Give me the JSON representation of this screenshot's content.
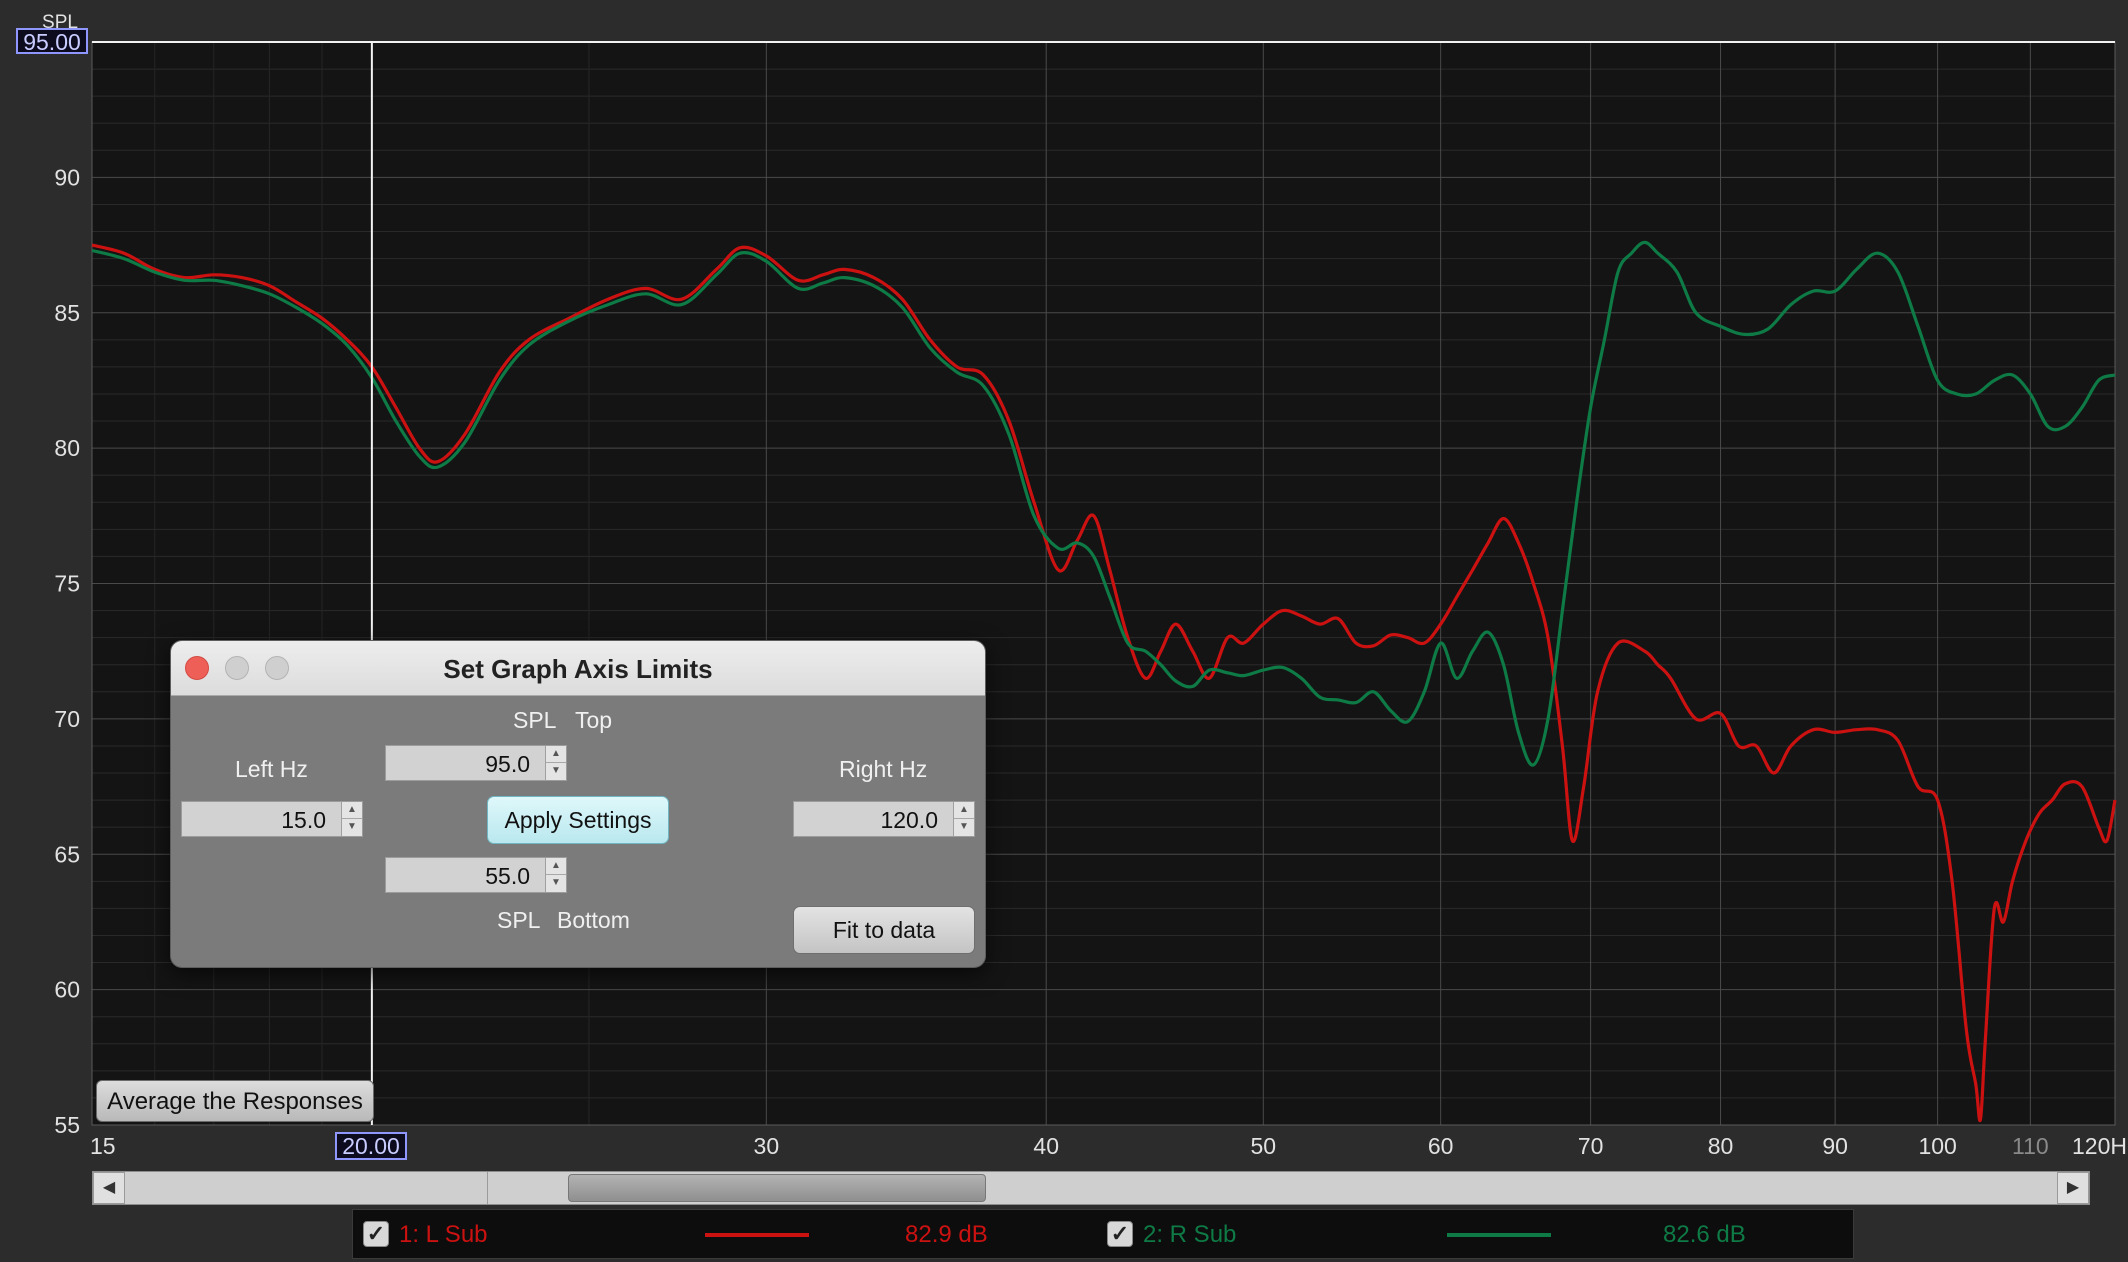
{
  "graph": {
    "y_axis_label": "SPL",
    "y_cursor_value": "95.00",
    "x_cursor_value": "20.00",
    "y_ticks": [
      "90",
      "85",
      "80",
      "75",
      "70",
      "65",
      "60",
      "55"
    ],
    "x_ticks": [
      "15",
      "30",
      "40",
      "50",
      "60",
      "70",
      "80",
      "90",
      "100",
      "110",
      "120H"
    ]
  },
  "chart_data": {
    "type": "line",
    "x_scale": "log",
    "xlim": [
      15,
      120
    ],
    "ylim": [
      55,
      95
    ],
    "ylabel": "SPL",
    "grid": true,
    "cursor": {
      "x": 20,
      "y": 95
    },
    "series": [
      {
        "name": "1: L Sub",
        "color": "#cc1111",
        "points": [
          [
            15,
            87.5
          ],
          [
            15.5,
            87.2
          ],
          [
            16,
            86.6
          ],
          [
            16.5,
            86.3
          ],
          [
            17,
            86.4
          ],
          [
            17.5,
            86.3
          ],
          [
            18,
            86.0
          ],
          [
            18.5,
            85.4
          ],
          [
            19,
            84.8
          ],
          [
            19.5,
            84.0
          ],
          [
            20,
            83.0
          ],
          [
            20.5,
            81.5
          ],
          [
            21,
            80.0
          ],
          [
            21.4,
            79.5
          ],
          [
            22,
            80.5
          ],
          [
            22.8,
            82.8
          ],
          [
            23.5,
            84.0
          ],
          [
            24.5,
            84.8
          ],
          [
            25.5,
            85.5
          ],
          [
            26.5,
            85.9
          ],
          [
            27.5,
            85.5
          ],
          [
            28.5,
            86.6
          ],
          [
            29.2,
            87.4
          ],
          [
            30,
            87.1
          ],
          [
            31,
            86.2
          ],
          [
            31.8,
            86.4
          ],
          [
            32.5,
            86.6
          ],
          [
            33.5,
            86.3
          ],
          [
            34.5,
            85.5
          ],
          [
            35.5,
            84.0
          ],
          [
            36.5,
            83.0
          ],
          [
            37.5,
            82.7
          ],
          [
            38.5,
            81.0
          ],
          [
            39.5,
            78.0
          ],
          [
            40.5,
            75.5
          ],
          [
            41.3,
            76.6
          ],
          [
            42,
            77.5
          ],
          [
            42.7,
            75.5
          ],
          [
            43.5,
            73.0
          ],
          [
            44.3,
            71.5
          ],
          [
            45,
            72.5
          ],
          [
            45.7,
            73.5
          ],
          [
            46.5,
            72.5
          ],
          [
            47.3,
            71.5
          ],
          [
            48.2,
            73.0
          ],
          [
            49,
            72.8
          ],
          [
            50,
            73.5
          ],
          [
            51,
            74.0
          ],
          [
            52,
            73.8
          ],
          [
            53,
            73.5
          ],
          [
            54,
            73.7
          ],
          [
            55,
            72.8
          ],
          [
            56,
            72.7
          ],
          [
            57,
            73.1
          ],
          [
            58,
            73.0
          ],
          [
            59,
            72.8
          ],
          [
            60,
            73.5
          ],
          [
            61,
            74.5
          ],
          [
            62,
            75.5
          ],
          [
            63,
            76.5
          ],
          [
            64,
            77.4
          ],
          [
            65,
            76.5
          ],
          [
            66,
            75.0
          ],
          [
            67,
            73.0
          ],
          [
            68,
            69.0
          ],
          [
            68.7,
            65.5
          ],
          [
            69.5,
            67.5
          ],
          [
            70.5,
            71.0
          ],
          [
            72,
            72.8
          ],
          [
            74,
            72.5
          ],
          [
            75,
            72.0
          ],
          [
            76,
            71.5
          ],
          [
            78,
            70.0
          ],
          [
            80,
            70.2
          ],
          [
            81.5,
            69.0
          ],
          [
            83,
            69.0
          ],
          [
            84.5,
            68.0
          ],
          [
            86,
            69.0
          ],
          [
            88,
            69.6
          ],
          [
            90,
            69.5
          ],
          [
            92,
            69.6
          ],
          [
            94,
            69.6
          ],
          [
            96,
            69.2
          ],
          [
            98,
            67.5
          ],
          [
            100,
            67.0
          ],
          [
            101.5,
            64.0
          ],
          [
            103,
            58.5
          ],
          [
            104,
            56.5
          ],
          [
            104.5,
            55.2
          ],
          [
            105,
            58.0
          ],
          [
            106,
            63.0
          ],
          [
            107,
            62.5
          ],
          [
            108,
            64.0
          ],
          [
            109.5,
            65.5
          ],
          [
            111,
            66.5
          ],
          [
            112.5,
            67.0
          ],
          [
            114,
            67.6
          ],
          [
            116,
            67.5
          ],
          [
            118,
            66.0
          ],
          [
            119,
            65.5
          ],
          [
            120,
            67.0
          ]
        ]
      },
      {
        "name": "2: R Sub",
        "color": "#0e7a45",
        "points": [
          [
            15,
            87.3
          ],
          [
            15.5,
            87.0
          ],
          [
            16,
            86.5
          ],
          [
            16.5,
            86.2
          ],
          [
            17,
            86.2
          ],
          [
            17.5,
            86.0
          ],
          [
            18,
            85.7
          ],
          [
            18.5,
            85.2
          ],
          [
            19,
            84.6
          ],
          [
            19.5,
            83.8
          ],
          [
            20,
            82.6
          ],
          [
            20.5,
            81.0
          ],
          [
            21,
            79.7
          ],
          [
            21.4,
            79.3
          ],
          [
            22,
            80.2
          ],
          [
            22.8,
            82.5
          ],
          [
            23.5,
            83.8
          ],
          [
            24.5,
            84.7
          ],
          [
            25.5,
            85.3
          ],
          [
            26.5,
            85.7
          ],
          [
            27.5,
            85.3
          ],
          [
            28.5,
            86.4
          ],
          [
            29.2,
            87.2
          ],
          [
            30,
            86.9
          ],
          [
            31,
            85.9
          ],
          [
            31.8,
            86.1
          ],
          [
            32.5,
            86.3
          ],
          [
            33.5,
            86.0
          ],
          [
            34.5,
            85.2
          ],
          [
            35.5,
            83.7
          ],
          [
            36.5,
            82.8
          ],
          [
            37.5,
            82.3
          ],
          [
            38.5,
            80.5
          ],
          [
            39.5,
            77.5
          ],
          [
            40.5,
            76.3
          ],
          [
            41.3,
            76.5
          ],
          [
            42,
            76.0
          ],
          [
            42.7,
            74.5
          ],
          [
            43.5,
            72.8
          ],
          [
            44.3,
            72.5
          ],
          [
            45,
            72.0
          ],
          [
            45.7,
            71.4
          ],
          [
            46.5,
            71.2
          ],
          [
            47.3,
            71.8
          ],
          [
            48.2,
            71.7
          ],
          [
            49,
            71.6
          ],
          [
            50,
            71.8
          ],
          [
            51,
            71.9
          ],
          [
            52,
            71.5
          ],
          [
            53,
            70.8
          ],
          [
            54,
            70.7
          ],
          [
            55,
            70.6
          ],
          [
            56,
            71.0
          ],
          [
            57,
            70.3
          ],
          [
            58,
            69.9
          ],
          [
            59,
            71.0
          ],
          [
            60,
            72.8
          ],
          [
            61,
            71.5
          ],
          [
            62,
            72.5
          ],
          [
            63,
            73.2
          ],
          [
            64,
            72.0
          ],
          [
            65,
            69.5
          ],
          [
            66,
            68.3
          ],
          [
            67,
            70.0
          ],
          [
            68,
            74.0
          ],
          [
            69,
            78.0
          ],
          [
            70,
            81.5
          ],
          [
            71,
            84.0
          ],
          [
            72,
            86.5
          ],
          [
            73,
            87.2
          ],
          [
            74,
            87.6
          ],
          [
            75,
            87.2
          ],
          [
            76.5,
            86.5
          ],
          [
            78,
            85.0
          ],
          [
            80,
            84.5
          ],
          [
            82,
            84.2
          ],
          [
            84,
            84.4
          ],
          [
            86,
            85.3
          ],
          [
            88,
            85.8
          ],
          [
            90,
            85.8
          ],
          [
            92,
            86.6
          ],
          [
            94,
            87.2
          ],
          [
            96,
            86.5
          ],
          [
            98,
            84.5
          ],
          [
            100,
            82.5
          ],
          [
            102,
            82.0
          ],
          [
            104,
            82.0
          ],
          [
            106,
            82.5
          ],
          [
            108,
            82.7
          ],
          [
            110,
            82.0
          ],
          [
            112,
            80.8
          ],
          [
            114,
            80.8
          ],
          [
            116,
            81.5
          ],
          [
            118,
            82.5
          ],
          [
            120,
            82.7
          ]
        ]
      }
    ]
  },
  "average_button": {
    "label": "Average the Responses"
  },
  "dialog": {
    "title": "Set Graph Axis Limits",
    "spl_top_label_1": "SPL",
    "spl_top_label_2": "Top",
    "spl_bottom_label_1": "SPL",
    "spl_bottom_label_2": "Bottom",
    "left_hz_label": "Left Hz",
    "right_hz_label": "Right Hz",
    "spl_top_value": "95.0",
    "spl_bottom_value": "55.0",
    "left_hz_value": "15.0",
    "right_hz_value": "120.0",
    "apply_label": "Apply Settings",
    "fit_label": "Fit to data"
  },
  "legend": {
    "items": [
      {
        "name": "1: L Sub",
        "value": "82.9 dB",
        "color": "#cc1111",
        "checked": true
      },
      {
        "name": "2: R Sub",
        "value": "82.6 dB",
        "color": "#0e7a45",
        "checked": true
      }
    ]
  }
}
